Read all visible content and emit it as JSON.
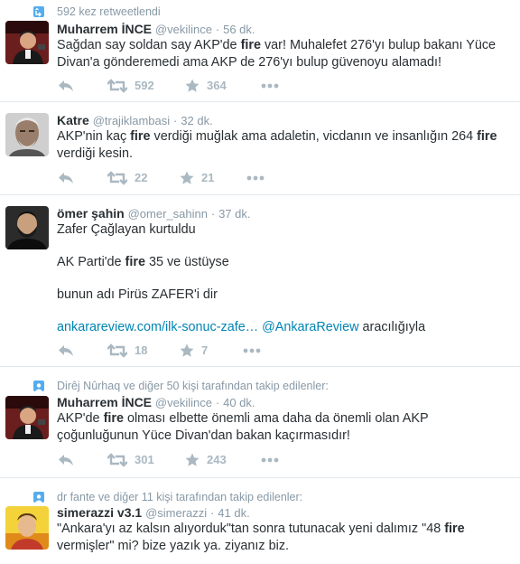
{
  "colors": {
    "icon_gray": "#aab8c2",
    "context_gray": "#8899a6",
    "retweet_blue": "#55acee",
    "link_blue": "#0084b4",
    "follow_blue": "#55acee"
  },
  "retweet_header": {
    "icon": "retweet-badge-icon",
    "text": "592 kez retweetlendi"
  },
  "tweets": [
    {
      "fullname": "Muharrem İNCE",
      "username": "@vekilince",
      "sep": "·",
      "time": "56 dk.",
      "text": [
        {
          "t": "Sağdan say soldan say AKP'de "
        },
        {
          "b": "fire"
        },
        {
          "t": " var! Muhalefet 276'yı bulup bakanı Yüce Divan'a gönderemedi ama AKP de 276'yı bulup güvenoyu alamadı!"
        }
      ],
      "retweets": "592",
      "favorites": "364"
    },
    {
      "fullname": "Katre",
      "username": "@trajiklambasi",
      "sep": "·",
      "time": "32 dk.",
      "text1": "AKP'nin kaç ",
      "bold1": "fire",
      "text2": " verdiği muğlak ama adaletin, vicdanın ve insanlığın 264 ",
      "bold2": "fire",
      "text3": " verdiği kesin.",
      "retweets": "22",
      "favorites": "21"
    },
    {
      "fullname": "ömer şahin",
      "username": "@omer_sahinn",
      "sep": "·",
      "time": "37 dk.",
      "line1": "Zafer Çağlayan kurtuldu",
      "line2a": "AK Parti'de ",
      "line2b": "fire",
      "line2c": " 35 ve üstüyse",
      "line3": "bunun adı Pirüs ZAFER'i dir",
      "link1": "ankarareview.com/ilk-sonuc-zafe…",
      "link2": "@AnkaraReview",
      "via": " aracılığıyla",
      "retweets": "18",
      "favorites": "7"
    },
    {
      "context": "Dirêj Nûrhaq ve diğer 50 kişi tarafından takip edilenler:",
      "fullname": "Muharrem İNCE",
      "username": "@vekilince",
      "sep": "·",
      "time": "40 dk.",
      "text1": "AKP'de ",
      "bold1": "fire",
      "text2": " olması elbette önemli ama daha da önemli olan AKP çoğunluğunun Yüce Divan'dan bakan kaçırmasıdır!",
      "retweets": "301",
      "favorites": "243"
    },
    {
      "context": "dr fante ve diğer 11 kişi tarafından takip edilenler:",
      "fullname": "simerazzi v3.1",
      "username": "@simerazzi",
      "sep": "·",
      "time": "41 dk.",
      "text1": "\"Ankara'yı az kalsın alıyorduk\"tan sonra tutunacak yeni dalımız \"48 ",
      "bold1": "fire",
      "text2": " vermişler\" mi? bize yazık ya. ziyanız biz."
    }
  ]
}
